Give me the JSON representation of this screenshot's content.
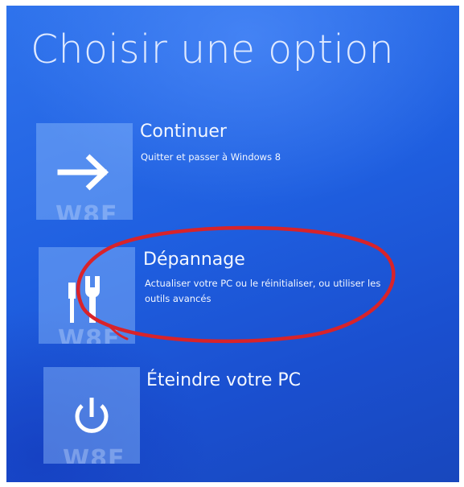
{
  "page": {
    "title": "Choisir une option"
  },
  "options": [
    {
      "title": "Continuer",
      "subtitle": "Quitter et passer à Windows 8",
      "icon": "arrow-right-icon",
      "watermark": "W8F"
    },
    {
      "title": "Dépannage",
      "subtitle": "Actualiser votre PC ou le réinitialiser, ou utiliser les outils avancés",
      "icon": "tools-icon",
      "watermark": "W8F"
    },
    {
      "title": "Éteindre votre PC",
      "subtitle": "",
      "icon": "power-icon",
      "watermark": "W8F"
    }
  ],
  "colors": {
    "background": "#2368e6",
    "tile": "#8fbcff",
    "highlight": "#d8232a"
  }
}
